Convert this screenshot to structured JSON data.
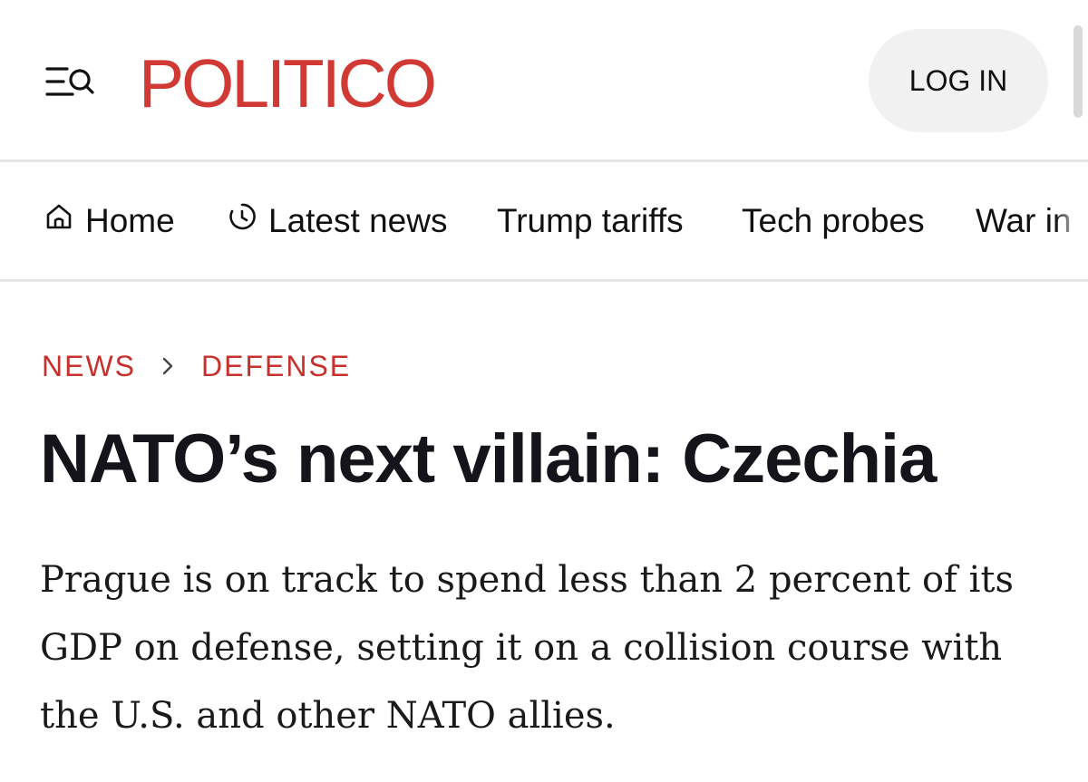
{
  "header": {
    "menu_icon": "menu-search-icon",
    "logo_text": "POLITICO",
    "login_label": "LOG IN"
  },
  "nav": {
    "items": [
      {
        "label": "Home",
        "icon": "home-icon"
      },
      {
        "label": "Latest news",
        "icon": "clock-icon"
      },
      {
        "label": "Trump tariffs"
      },
      {
        "label": "Tech probes"
      },
      {
        "label": "War in"
      }
    ]
  },
  "article": {
    "breadcrumb": [
      "NEWS",
      "DEFENSE"
    ],
    "breadcrumb_separator_icon": "chevron-right-icon",
    "headline": "NATO’s next villain: Czechia",
    "dek": "Prague is on track to spend less than 2 percent of its GDP on defense, setting it on a collision course with the U.S. and other NATO allies."
  },
  "colors": {
    "brand": "#d13a34",
    "breadcrumb": "#c8302c",
    "text": "#111111",
    "button_bg": "#f1f1f1",
    "divider": "#e6e6e6"
  }
}
